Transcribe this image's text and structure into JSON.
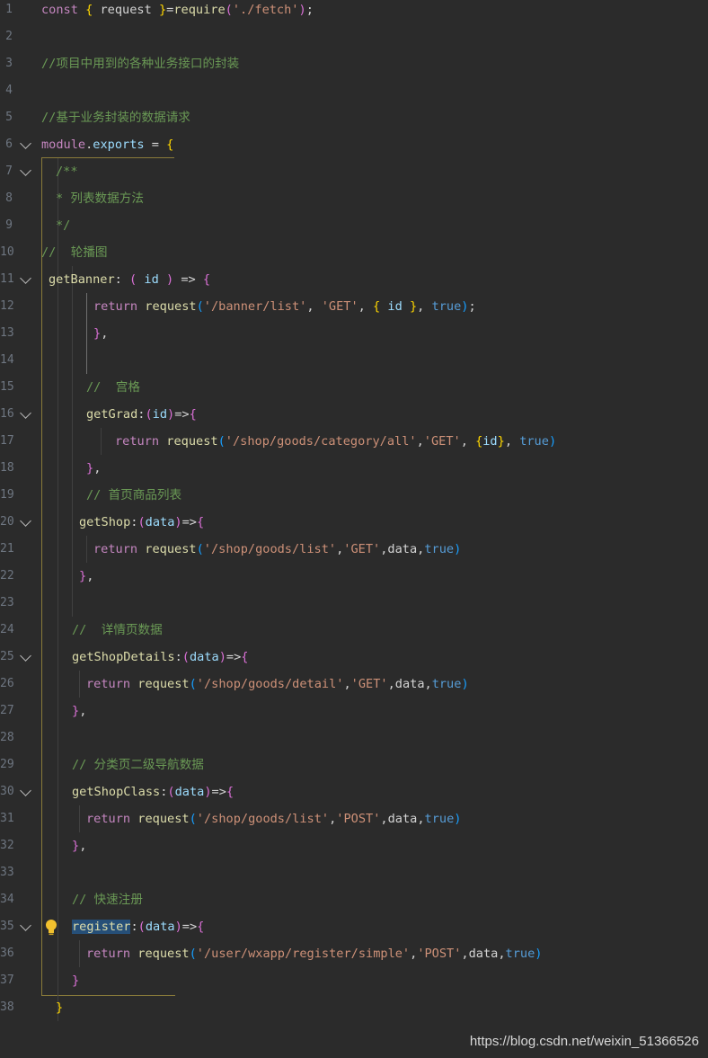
{
  "editor": {
    "lines": [
      {
        "n": "1",
        "segments": [
          [
            "kw",
            "const "
          ],
          [
            "br1",
            "{ "
          ],
          [
            "op",
            "request "
          ],
          [
            "br1",
            "}"
          ],
          [
            "op",
            "="
          ],
          [
            "fn",
            "require"
          ],
          [
            "br2",
            "("
          ],
          [
            "str",
            "'./fetch'"
          ],
          [
            "br2",
            ")"
          ],
          [
            "op",
            ";"
          ]
        ]
      },
      {
        "n": "2",
        "segments": []
      },
      {
        "n": "3",
        "segments": [
          [
            "cm",
            "//项目中用到的各种业务接口的封装"
          ]
        ]
      },
      {
        "n": "4",
        "segments": []
      },
      {
        "n": "5",
        "segments": [
          [
            "cm",
            "//基于业务封装的数据请求"
          ]
        ]
      },
      {
        "n": "6",
        "fold": true,
        "segments": [
          [
            "kw",
            "module"
          ],
          [
            "op",
            "."
          ],
          [
            "prop",
            "exports"
          ],
          [
            "op",
            " = "
          ],
          [
            "br1",
            "{"
          ]
        ]
      },
      {
        "n": "7",
        "fold": true,
        "segments": [
          [
            "cm",
            "/**"
          ]
        ]
      },
      {
        "n": "8",
        "segments": [
          [
            "cm",
            "* 列表数据方法"
          ]
        ]
      },
      {
        "n": "9",
        "segments": [
          [
            "cm",
            "*/"
          ]
        ]
      },
      {
        "n": "10",
        "segments": [
          [
            "cm",
            "//  轮播图"
          ]
        ]
      },
      {
        "n": "11",
        "fold": true,
        "segments": [
          [
            "fn",
            "getBanner"
          ],
          [
            "op",
            ": "
          ],
          [
            "br2",
            "( "
          ],
          [
            "pm",
            "id"
          ],
          [
            "br2",
            " )"
          ],
          [
            "op",
            " => "
          ],
          [
            "br2",
            "{"
          ]
        ]
      },
      {
        "n": "12",
        "segments": [
          [
            "ctl",
            "return "
          ],
          [
            "fn",
            "request"
          ],
          [
            "br3",
            "("
          ],
          [
            "str",
            "'/banner/list'"
          ],
          [
            "op",
            ", "
          ],
          [
            "str",
            "'GET'"
          ],
          [
            "op",
            ", "
          ],
          [
            "br1",
            "{ "
          ],
          [
            "pm",
            "id"
          ],
          [
            "br1",
            " }"
          ],
          [
            "op",
            ", "
          ],
          [
            "bool",
            "true"
          ],
          [
            "br3",
            ")"
          ],
          [
            "op",
            ";"
          ]
        ]
      },
      {
        "n": "13",
        "segments": [
          [
            "br2",
            "}"
          ],
          [
            "op",
            ","
          ]
        ]
      },
      {
        "n": "14",
        "segments": []
      },
      {
        "n": "15",
        "segments": [
          [
            "cm",
            "//  宫格"
          ]
        ]
      },
      {
        "n": "16",
        "fold": true,
        "segments": [
          [
            "fn",
            "getGrad"
          ],
          [
            "op",
            ":"
          ],
          [
            "br2",
            "("
          ],
          [
            "pm",
            "id"
          ],
          [
            "br2",
            ")"
          ],
          [
            "op",
            "=>"
          ],
          [
            "br2",
            "{"
          ]
        ]
      },
      {
        "n": "17",
        "segments": [
          [
            "ctl",
            "return "
          ],
          [
            "fn",
            "request"
          ],
          [
            "br3",
            "("
          ],
          [
            "str",
            "'/shop/goods/category/all'"
          ],
          [
            "op",
            ","
          ],
          [
            "str",
            "'GET'"
          ],
          [
            "op",
            ", "
          ],
          [
            "br1",
            "{"
          ],
          [
            "pm",
            "id"
          ],
          [
            "br1",
            "}"
          ],
          [
            "op",
            ", "
          ],
          [
            "bool",
            "true"
          ],
          [
            "br3",
            ")"
          ]
        ]
      },
      {
        "n": "18",
        "segments": [
          [
            "br2",
            "}"
          ],
          [
            "op",
            ","
          ]
        ]
      },
      {
        "n": "19",
        "segments": [
          [
            "cm",
            "// 首页商品列表"
          ]
        ]
      },
      {
        "n": "20",
        "fold": true,
        "segments": [
          [
            "fn",
            "getShop"
          ],
          [
            "op",
            ":"
          ],
          [
            "br2",
            "("
          ],
          [
            "pm",
            "data"
          ],
          [
            "br2",
            ")"
          ],
          [
            "op",
            "=>"
          ],
          [
            "br2",
            "{"
          ]
        ]
      },
      {
        "n": "21",
        "segments": [
          [
            "ctl",
            "return "
          ],
          [
            "fn",
            "request"
          ],
          [
            "br3",
            "("
          ],
          [
            "str",
            "'/shop/goods/list'"
          ],
          [
            "op",
            ","
          ],
          [
            "str",
            "'GET'"
          ],
          [
            "op",
            ",data,"
          ],
          [
            "bool",
            "true"
          ],
          [
            "br3",
            ")"
          ]
        ]
      },
      {
        "n": "22",
        "segments": [
          [
            "br2",
            "}"
          ],
          [
            "op",
            ","
          ]
        ]
      },
      {
        "n": "23",
        "segments": []
      },
      {
        "n": "24",
        "segments": [
          [
            "cm",
            "//  详情页数据"
          ]
        ]
      },
      {
        "n": "25",
        "fold": true,
        "segments": [
          [
            "fn",
            "getShopDetails"
          ],
          [
            "op",
            ":"
          ],
          [
            "br2",
            "("
          ],
          [
            "pm",
            "data"
          ],
          [
            "br2",
            ")"
          ],
          [
            "op",
            "=>"
          ],
          [
            "br2",
            "{"
          ]
        ]
      },
      {
        "n": "26",
        "segments": [
          [
            "ctl",
            "return "
          ],
          [
            "fn",
            "request"
          ],
          [
            "br3",
            "("
          ],
          [
            "str",
            "'/shop/goods/detail'"
          ],
          [
            "op",
            ","
          ],
          [
            "str",
            "'GET'"
          ],
          [
            "op",
            ",data,"
          ],
          [
            "bool",
            "true"
          ],
          [
            "br3",
            ")"
          ]
        ]
      },
      {
        "n": "27",
        "segments": [
          [
            "br2",
            "}"
          ],
          [
            "op",
            ","
          ]
        ]
      },
      {
        "n": "28",
        "segments": []
      },
      {
        "n": "29",
        "segments": [
          [
            "cm",
            "// 分类页二级导航数据"
          ]
        ]
      },
      {
        "n": "30",
        "fold": true,
        "segments": [
          [
            "fn",
            "getShopClass"
          ],
          [
            "op",
            ":"
          ],
          [
            "br2",
            "("
          ],
          [
            "pm",
            "data"
          ],
          [
            "br2",
            ")"
          ],
          [
            "op",
            "=>"
          ],
          [
            "br2",
            "{"
          ]
        ]
      },
      {
        "n": "31",
        "segments": [
          [
            "ctl",
            "return "
          ],
          [
            "fn",
            "request"
          ],
          [
            "br3",
            "("
          ],
          [
            "str",
            "'/shop/goods/list'"
          ],
          [
            "op",
            ","
          ],
          [
            "str",
            "'POST'"
          ],
          [
            "op",
            ",data,"
          ],
          [
            "bool",
            "true"
          ],
          [
            "br3",
            ")"
          ]
        ]
      },
      {
        "n": "32",
        "segments": [
          [
            "br2",
            "}"
          ],
          [
            "op",
            ","
          ]
        ]
      },
      {
        "n": "33",
        "segments": []
      },
      {
        "n": "34",
        "segments": [
          [
            "cm",
            "// 快速注册"
          ]
        ]
      },
      {
        "n": "35",
        "fold": true,
        "bulb": true,
        "segments": [
          [
            "fn hl",
            "register"
          ],
          [
            "op",
            ":"
          ],
          [
            "br2",
            "("
          ],
          [
            "pm",
            "data"
          ],
          [
            "br2",
            ")"
          ],
          [
            "op",
            "=>"
          ],
          [
            "br2",
            "{"
          ]
        ]
      },
      {
        "n": "36",
        "segments": [
          [
            "ctl",
            "return "
          ],
          [
            "fn",
            "request"
          ],
          [
            "br3",
            "("
          ],
          [
            "str",
            "'/user/wxapp/register/simple'"
          ],
          [
            "op",
            ","
          ],
          [
            "str",
            "'POST'"
          ],
          [
            "op",
            ",data,"
          ],
          [
            "bool",
            "true"
          ],
          [
            "br3",
            ")"
          ]
        ]
      },
      {
        "n": "37",
        "segments": [
          [
            "br2",
            "}"
          ]
        ]
      },
      {
        "n": "38",
        "segments": [
          [
            "br1",
            "}"
          ]
        ]
      }
    ]
  },
  "watermark": "https://blog.csdn.net/weixin_51366526"
}
